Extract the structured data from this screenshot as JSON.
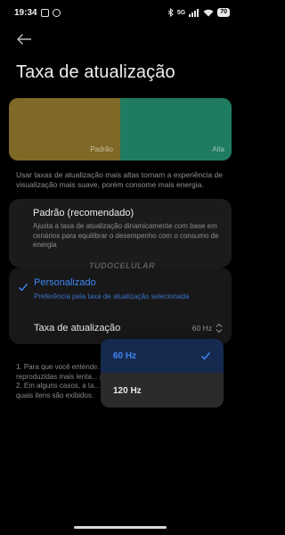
{
  "status_bar": {
    "time": "19:34",
    "network": "5G",
    "battery": "70"
  },
  "page": {
    "title": "Taxa de atualização"
  },
  "preview": {
    "left_label": "Padrão",
    "right_label": "Alta",
    "left_color": "#7f6926",
    "right_color": "#1f7c61"
  },
  "description": "Usar taxas de atualização mais altas tornam a experiência de visualização mais suave, porém consome mais energia.",
  "options": {
    "default": {
      "title": "Padrão (recomendado)",
      "subtitle": "Ajusta a taxa de atualização dinamicamente com base em cenários para equilibrar o desempenho com o consumo de energia"
    },
    "custom": {
      "title": "Personalizado",
      "subtitle": "Preferência pela taxa de atualização selecionada",
      "selected": true,
      "rate_label": "Taxa de atualização",
      "rate_value": "60 Hz"
    }
  },
  "watermark": "TUDOCELULAR",
  "footnotes": [
    "1. Para que você entende... atualização baixas e alt... reproduzidas mais lenta... perceber a diferença du...",
    "2. Em alguns casos, a ta... ajustada dinamicamente com base em quais itens são exibidos."
  ],
  "dropdown": {
    "options": [
      {
        "label": "60 Hz",
        "selected": true
      },
      {
        "label": "120 Hz",
        "selected": false
      }
    ]
  },
  "colors": {
    "accent": "#3e86f2",
    "background": "#000000",
    "card": "#1b1b1b"
  }
}
